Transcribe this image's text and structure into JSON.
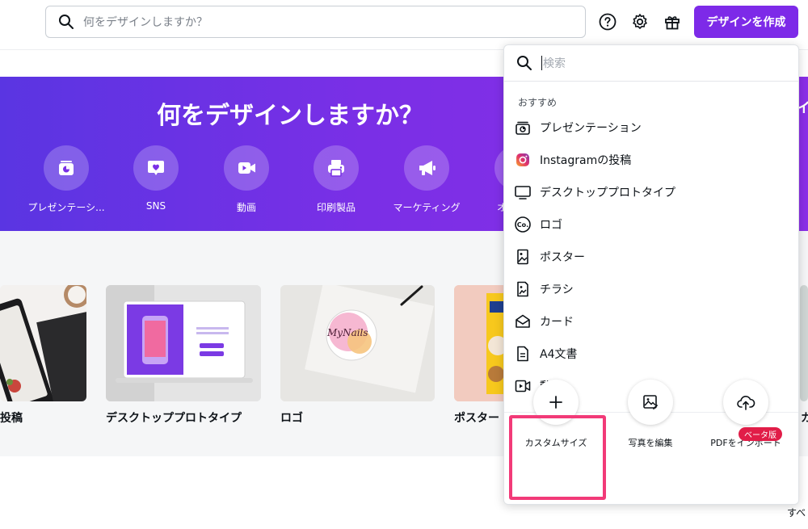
{
  "header": {
    "search_placeholder": "何をデザインしますか？",
    "create_button": "デザインを作成",
    "icons": [
      "help-icon",
      "settings-icon",
      "gift-icon"
    ]
  },
  "hero": {
    "title": "何をデザインしますか？",
    "categories": [
      {
        "label": "プレゼンテーシ...",
        "icon": "presentation-icon"
      },
      {
        "label": "SNS",
        "icon": "heart-chat-icon"
      },
      {
        "label": "動画",
        "icon": "video-camera-icon"
      },
      {
        "label": "印刷製品",
        "icon": "printer-icon"
      },
      {
        "label": "マーケティング",
        "icon": "megaphone-icon"
      }
    ]
  },
  "templates": [
    {
      "label": "投稿"
    },
    {
      "label": "デスクトッププロトタイプ"
    },
    {
      "label": "ロゴ",
      "art_text": "MyNails"
    },
    {
      "label": "ポスター"
    }
  ],
  "see_all": "すべ",
  "dropdown": {
    "search_placeholder": "検索",
    "heading": "おすすめ",
    "items": [
      {
        "label": "プレゼンテーション",
        "icon": "presentation-icon"
      },
      {
        "label": "Instagramの投稿",
        "icon": "instagram-icon"
      },
      {
        "label": "デスクトッププロトタイプ",
        "icon": "monitor-icon"
      },
      {
        "label": "ロゴ",
        "icon": "logo-co-icon"
      },
      {
        "label": "ポスター",
        "icon": "poster-icon"
      },
      {
        "label": "チラシ",
        "icon": "flyer-icon"
      },
      {
        "label": "カード",
        "icon": "card-envelope-icon"
      },
      {
        "label": "A4文書",
        "icon": "document-icon"
      },
      {
        "label": "動画",
        "icon": "video-icon"
      }
    ],
    "footer": [
      {
        "label": "カスタムサイズ",
        "icon": "plus-icon"
      },
      {
        "label": "写真を編集",
        "icon": "photo-edit-icon"
      },
      {
        "label": "PDFをインポート",
        "icon": "cloud-upload-icon",
        "badge": "ベータ版"
      }
    ]
  },
  "colors": {
    "accent": "#7d2ae8",
    "highlight": "#f23a78",
    "badge": "#e11d48"
  }
}
